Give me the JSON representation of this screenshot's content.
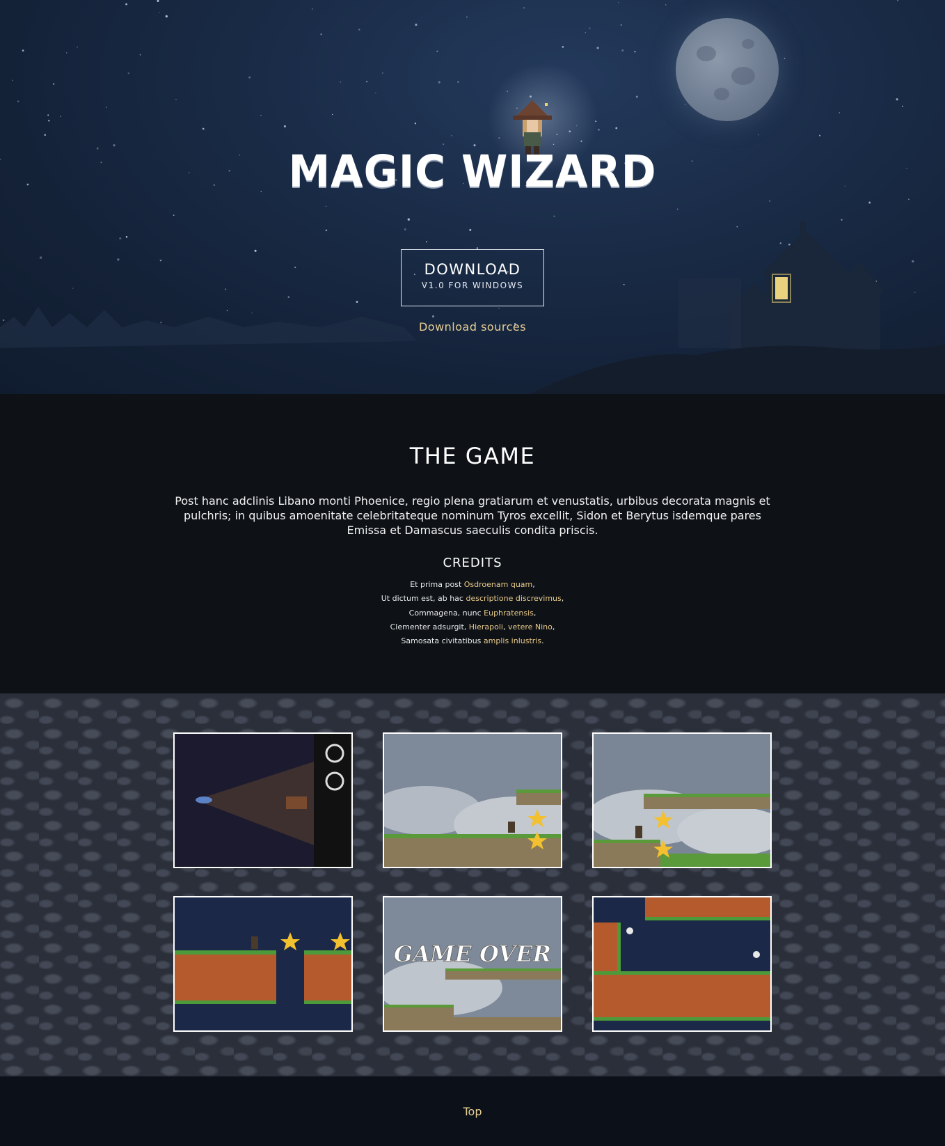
{
  "hero": {
    "title": "MAGIC WIZARD",
    "download_label": "DOWNLOAD",
    "download_sub": "V1.0 FOR WINDOWS",
    "sources_link": "Download sources"
  },
  "game": {
    "heading": "THE GAME",
    "description": "Post hanc adclinis Libano monti Phoenice, regio plena gratiarum et venustatis, urbibus decorata magnis et pulchris; in quibus amoenitate celebritateque nominum Tyros excellit, Sidon et Berytus isdemque pares Emissa et Damascus saeculis condita priscis.",
    "credits_heading": "CREDITS",
    "credits": [
      {
        "text": "Et prima post ",
        "links": [
          "Osdroenam quam"
        ],
        "tail": ","
      },
      {
        "text": "Ut dictum est, ab hac ",
        "links": [
          "descriptione discrevimus"
        ],
        "tail": ","
      },
      {
        "text": "Commagena, nunc ",
        "links": [
          "Euphratensis"
        ],
        "tail": ","
      },
      {
        "text": "Clementer adsurgit, ",
        "links": [
          "Hierapoli",
          "vetere Nino"
        ],
        "tail": ","
      },
      {
        "text": "Samosata civitatibus ",
        "links": [
          "amplis inlustris"
        ],
        "tail": "."
      }
    ]
  },
  "gallery": {
    "screenshots": [
      {
        "name": "tv-screen"
      },
      {
        "name": "clouds-level-1"
      },
      {
        "name": "clouds-level-2"
      },
      {
        "name": "night-dirt-level"
      },
      {
        "name": "game-over",
        "caption": "GAME OVER"
      },
      {
        "name": "night-dirt-level-2"
      }
    ]
  },
  "footer": {
    "top_link": "Top"
  },
  "colors": {
    "accent": "#e7cf95",
    "hero_sky": "#1a2c48",
    "game_bg": "#0e1217",
    "footer_bg": "#0c1119"
  }
}
